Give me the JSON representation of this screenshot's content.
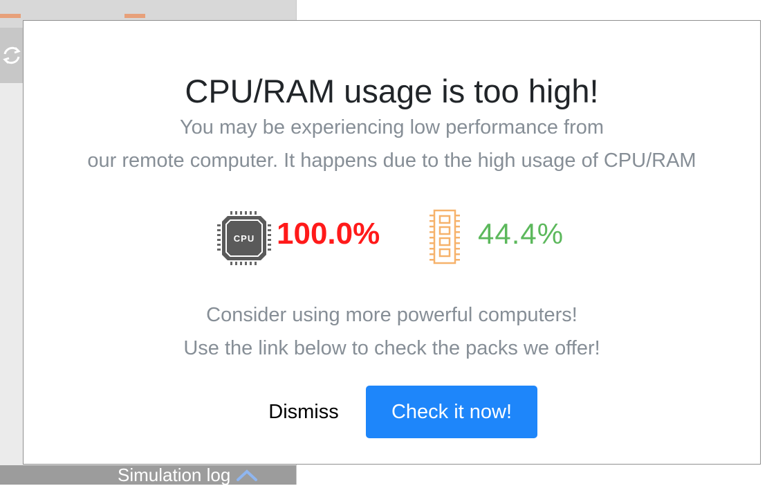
{
  "background": {
    "simulation_log_label": "Simulation log",
    "chevron_icon": "chevron-up-icon",
    "refresh_icon": "refresh-icon"
  },
  "modal": {
    "title": "CPU/RAM usage is too high!",
    "description_line1": "You may be experiencing low performance from",
    "description_line2": "our remote computer. It happens due to the high usage of CPU/RAM",
    "cpu": {
      "icon": "cpu-chip-icon",
      "icon_label": "CPU",
      "value": "100.0%",
      "color": "#ff1a1a"
    },
    "ram": {
      "icon": "ram-module-icon",
      "value": "44.4%",
      "color": "#5cb85c",
      "icon_color": "#f6b26b"
    },
    "consider_line1": "Consider using more powerful computers!",
    "consider_line2": "Use the link below to check the packs we offer!",
    "dismiss_label": "Dismiss",
    "check_label": "Check it now!",
    "accent_color": "#1e86fa"
  }
}
